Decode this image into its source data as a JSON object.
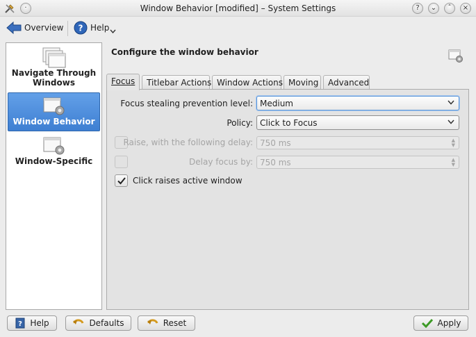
{
  "window": {
    "title": "Window Behavior [modified] – System Settings",
    "app_icon": "tools-icon",
    "title_buttons": [
      "help-icon",
      "minimize-icon",
      "maximize-icon",
      "close-icon"
    ]
  },
  "toolbar": {
    "overview_label": "Overview",
    "help_label": "Help"
  },
  "sidebar": {
    "items": [
      {
        "label": "Navigate Through Windows",
        "icon": "windows-stack-icon",
        "selected": false
      },
      {
        "label": "Window Behavior",
        "icon": "window-gear-icon",
        "selected": true
      },
      {
        "label": "Window-Specific",
        "icon": "window-gear-icon",
        "selected": false
      }
    ]
  },
  "main": {
    "title": "Configure the window behavior",
    "tabs": [
      {
        "label": "Focus",
        "active": true
      },
      {
        "label": "Titlebar Actions",
        "active": false
      },
      {
        "label": "Window Actions",
        "active": false
      },
      {
        "label": "Moving",
        "active": false
      },
      {
        "label": "Advanced",
        "active": false
      }
    ],
    "focus": {
      "stealing_label": "Focus stealing prevention level:",
      "stealing_value": "Medium",
      "policy_label": "Policy:",
      "policy_value": "Click to Focus",
      "raise_label": "Raise, with the following delay:",
      "raise_checked": false,
      "raise_delay": "750 ms",
      "delay_focus_label": "Delay focus by:",
      "delay_focus_checked": false,
      "delay_focus_value": "750 ms",
      "click_raises_label": "Click raises active window",
      "click_raises_checked": true
    }
  },
  "buttons": {
    "help": "Help",
    "defaults": "Defaults",
    "reset": "Reset",
    "apply": "Apply"
  },
  "colors": {
    "selection": "#4a8ad9",
    "background": "#ececec",
    "panel": "#e3e3e3",
    "disabled_text": "#a5a5a5"
  }
}
